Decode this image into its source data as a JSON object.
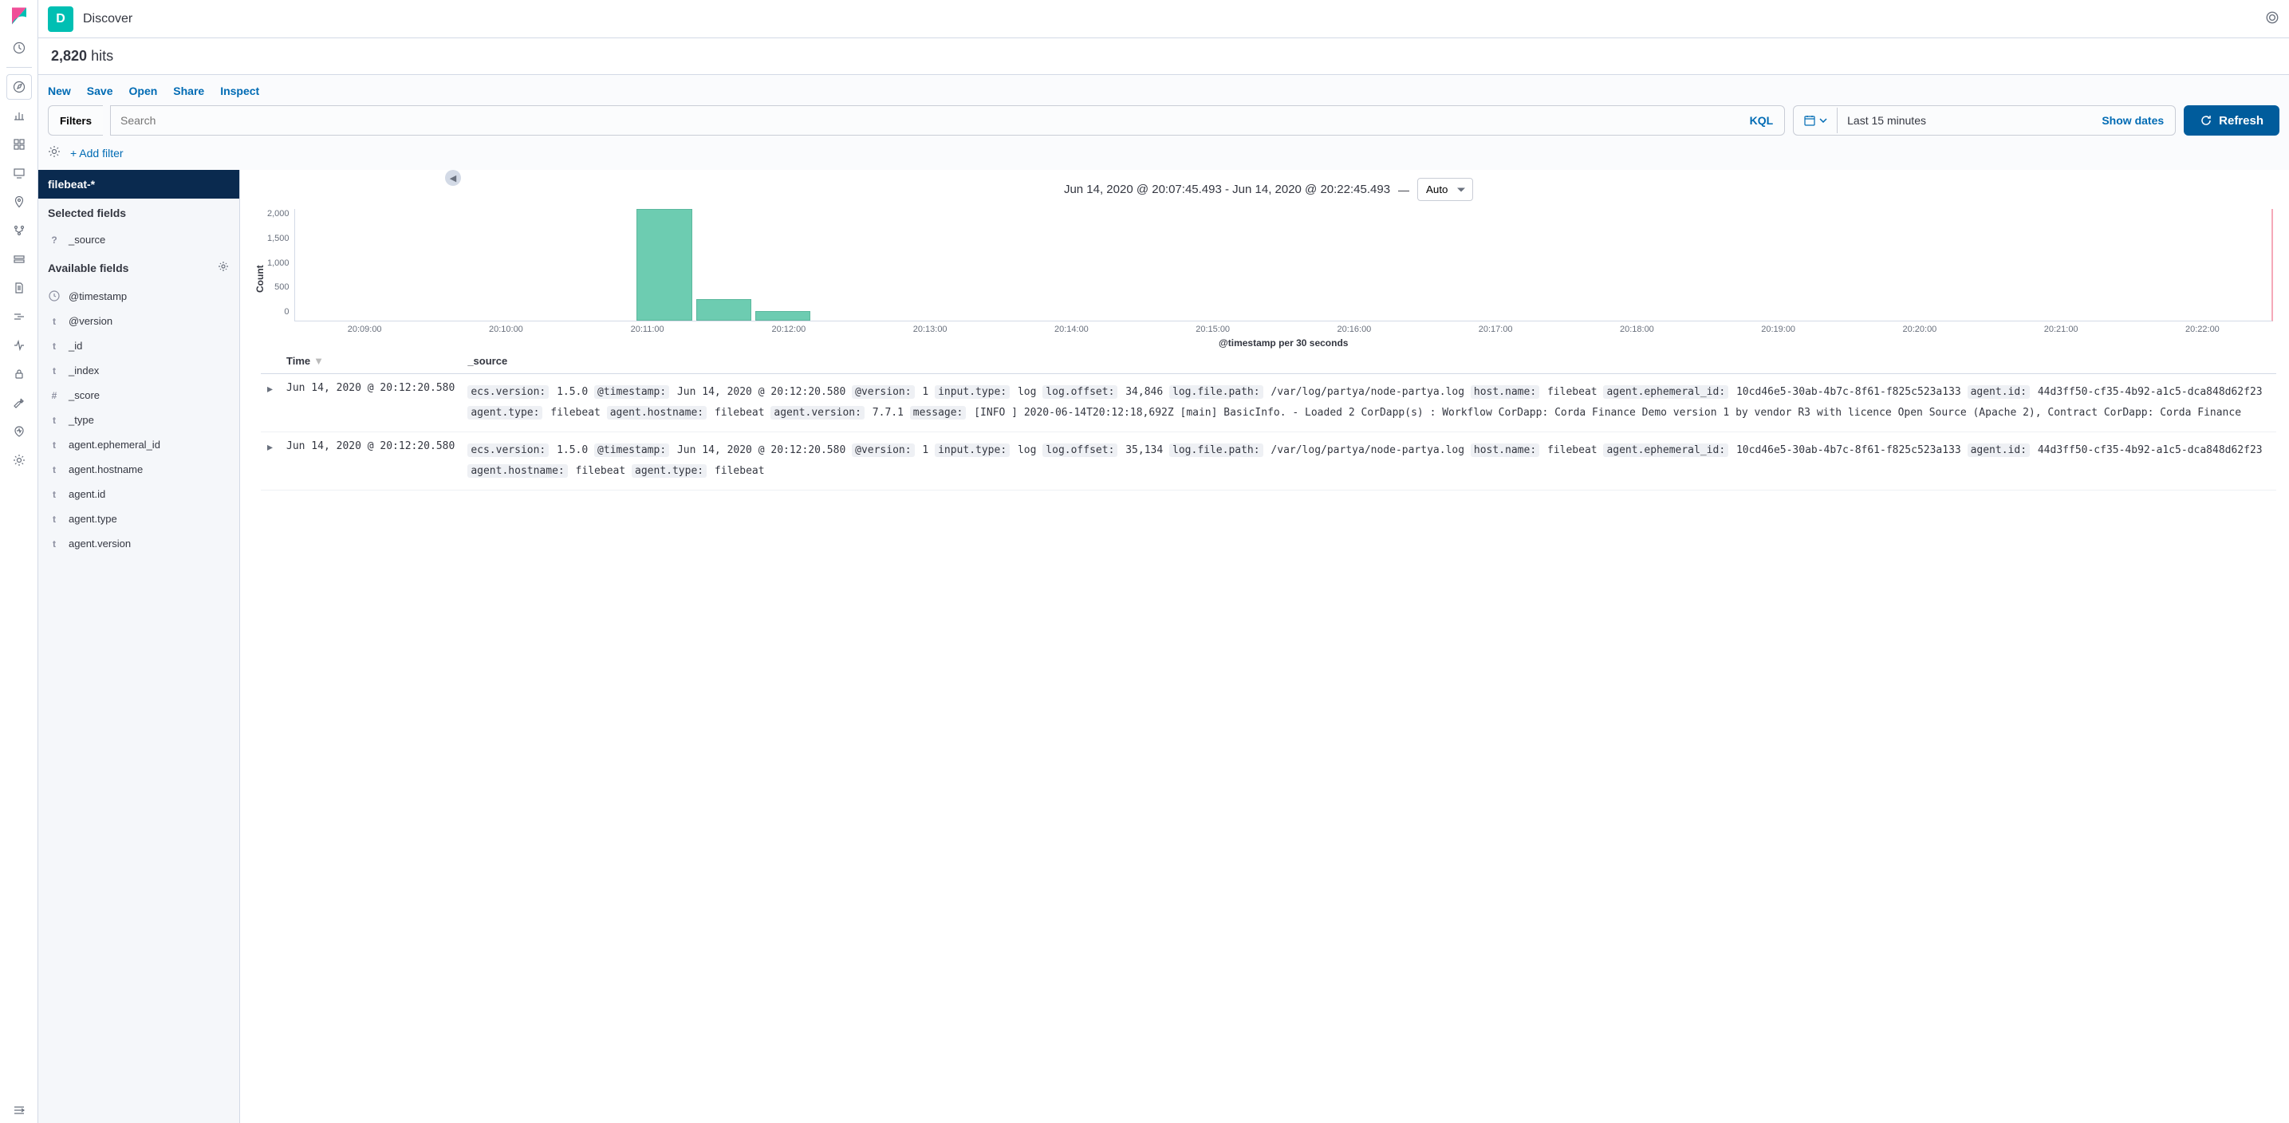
{
  "header": {
    "app_badge": "D",
    "breadcrumb": "Discover"
  },
  "hits": {
    "count": "2,820",
    "label": "hits"
  },
  "menu": {
    "new": "New",
    "save": "Save",
    "open": "Open",
    "share": "Share",
    "inspect": "Inspect"
  },
  "query": {
    "filters_label": "Filters",
    "search_placeholder": "Search",
    "kql_label": "KQL",
    "date_text": "Last 15 minutes",
    "show_dates": "Show dates",
    "refresh": "Refresh",
    "add_filter": "+ Add filter"
  },
  "sidebar": {
    "index_pattern": "filebeat-*",
    "selected_title": "Selected fields",
    "selected": [
      {
        "type": "?",
        "name": "_source"
      }
    ],
    "available_title": "Available fields",
    "available": [
      {
        "type": "clock",
        "name": "@timestamp"
      },
      {
        "type": "t",
        "name": "@version"
      },
      {
        "type": "t",
        "name": "_id"
      },
      {
        "type": "t",
        "name": "_index"
      },
      {
        "type": "#",
        "name": "_score"
      },
      {
        "type": "t",
        "name": "_type"
      },
      {
        "type": "t",
        "name": "agent.ephemeral_id"
      },
      {
        "type": "t",
        "name": "agent.hostname"
      },
      {
        "type": "t",
        "name": "agent.id"
      },
      {
        "type": "t",
        "name": "agent.type"
      },
      {
        "type": "t",
        "name": "agent.version"
      }
    ]
  },
  "histogram": {
    "range": "Jun 14, 2020 @ 20:07:45.493 - Jun 14, 2020 @ 20:22:45.493",
    "dash": "—",
    "interval": "Auto",
    "xlabel": "@timestamp per 30 seconds"
  },
  "table": {
    "col_time": "Time",
    "col_source": "_source",
    "rows": [
      {
        "time": "Jun 14, 2020 @ 20:12:20.580",
        "fields": [
          {
            "k": "ecs.version:",
            "v": "1.5.0"
          },
          {
            "k": "@timestamp:",
            "v": "Jun 14, 2020 @ 20:12:20.580"
          },
          {
            "k": "@version:",
            "v": "1"
          },
          {
            "k": "input.type:",
            "v": "log"
          },
          {
            "k": "log.offset:",
            "v": "34,846"
          },
          {
            "k": "log.file.path:",
            "v": "/var/log/partya/node-partya.log"
          },
          {
            "k": "host.name:",
            "v": "filebeat"
          },
          {
            "k": "agent.ephemeral_id:",
            "v": "10cd46e5-30ab-4b7c-8f61-f825c523a133"
          },
          {
            "k": "agent.id:",
            "v": "44d3ff50-cf35-4b92-a1c5-dca848d62f23"
          },
          {
            "k": "agent.type:",
            "v": "filebeat"
          },
          {
            "k": "agent.hostname:",
            "v": "filebeat"
          },
          {
            "k": "agent.version:",
            "v": "7.7.1"
          },
          {
            "k": "message:",
            "v": "[INFO ] 2020-06-14T20:12:18,692Z [main] BasicInfo. - Loaded 2 CorDapp(s) : Workflow CorDapp: Corda Finance Demo version 1 by vendor R3 with licence Open Source (Apache 2), Contract CorDapp: Corda Finance"
          }
        ]
      },
      {
        "time": "Jun 14, 2020 @ 20:12:20.580",
        "fields": [
          {
            "k": "ecs.version:",
            "v": "1.5.0"
          },
          {
            "k": "@timestamp:",
            "v": "Jun 14, 2020 @ 20:12:20.580"
          },
          {
            "k": "@version:",
            "v": "1"
          },
          {
            "k": "input.type:",
            "v": "log"
          },
          {
            "k": "log.offset:",
            "v": "35,134"
          },
          {
            "k": "log.file.path:",
            "v": "/var/log/partya/node-partya.log"
          },
          {
            "k": "host.name:",
            "v": "filebeat"
          },
          {
            "k": "agent.ephemeral_id:",
            "v": "10cd46e5-30ab-4b7c-8f61-f825c523a133"
          },
          {
            "k": "agent.id:",
            "v": "44d3ff50-cf35-4b92-a1c5-dca848d62f23"
          },
          {
            "k": "agent.hostname:",
            "v": "filebeat"
          },
          {
            "k": "agent.type:",
            "v": "filebeat"
          }
        ]
      }
    ]
  },
  "chart_data": {
    "type": "bar",
    "ylabel": "Count",
    "ylim": [
      0,
      2200
    ],
    "yticks": [
      0,
      500,
      1000,
      1500,
      2000
    ],
    "xticks": [
      "20:09:00",
      "20:10:00",
      "20:11:00",
      "20:12:00",
      "20:13:00",
      "20:14:00",
      "20:15:00",
      "20:16:00",
      "20:17:00",
      "20:18:00",
      "20:19:00",
      "20:20:00",
      "20:21:00",
      "20:22:00"
    ],
    "bars": [
      {
        "x_percent": 17.3,
        "width_percent": 2.8,
        "value": 2200
      },
      {
        "x_percent": 20.3,
        "width_percent": 2.8,
        "value": 420
      },
      {
        "x_percent": 23.3,
        "width_percent": 2.8,
        "value": 190
      }
    ]
  }
}
